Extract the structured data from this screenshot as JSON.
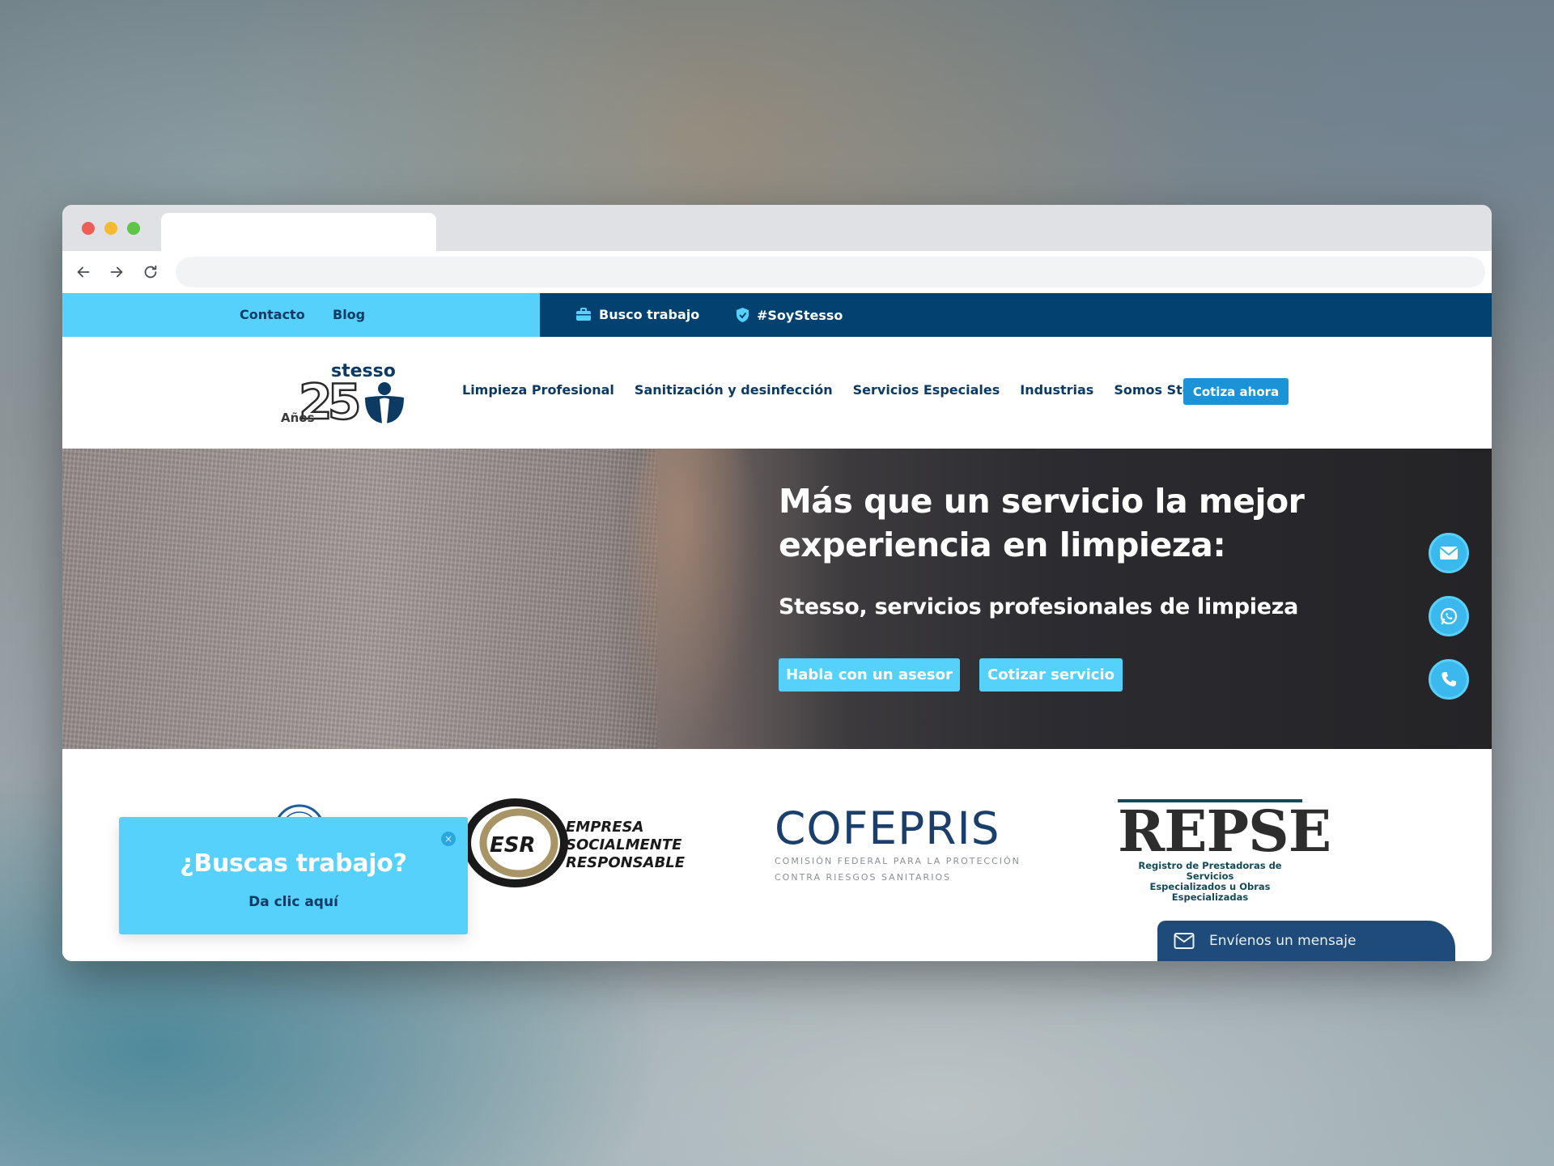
{
  "browser": {
    "active_tab_title": "",
    "url": ""
  },
  "topbar": {
    "contact_label": "Contacto",
    "blog_label": "Blog",
    "job_label": "Busco trabajo",
    "hashtag_label": "#SoyStesso"
  },
  "header": {
    "logo_brand": "stesso",
    "logo_years_number": "25",
    "logo_years_word": "Años",
    "nav": [
      {
        "label": "Limpieza Profesional"
      },
      {
        "label": "Sanitización y desinfección"
      },
      {
        "label": "Servicios Especiales"
      },
      {
        "label": "Industrias"
      },
      {
        "label": "Somos Stesso"
      }
    ],
    "cta_label": "Cotiza ahora"
  },
  "hero": {
    "title": "Más que un servicio la mejor experiencia en limpieza:",
    "subtitle": "Stesso, servicios profesionales de limpieza",
    "primary_button": "Habla con un asesor",
    "secondary_button": "Cotizar servicio",
    "side_icons": [
      "envelope-icon",
      "whatsapp-icon",
      "phone-icon"
    ]
  },
  "certifications": {
    "esr_badge": "ESR",
    "esr_lines": [
      "EMPRESA",
      "SOCIALMENTE",
      "RESPONSABLE"
    ],
    "cofepris_name": "COFEPRIS",
    "cofepris_lines": [
      "COMISIÓN FEDERAL PARA LA PROTECCIÓN",
      "CONTRA RIESGOS SANITARIOS"
    ],
    "repse_name": "REPSE",
    "repse_lines": [
      "Registro de Prestadoras de Servicios",
      "Especializados u Obras Especializadas"
    ]
  },
  "popup": {
    "title": "¿Buscas trabajo?",
    "subtitle": "Da clic aquí",
    "close_symbol": "×"
  },
  "message_bar": {
    "label": "Envíenos un mensaje"
  },
  "colors": {
    "accent_light_blue": "#55d1fc",
    "navy": "#024170",
    "nav_text": "#0c3a63",
    "cta_blue": "#1b93d6"
  }
}
